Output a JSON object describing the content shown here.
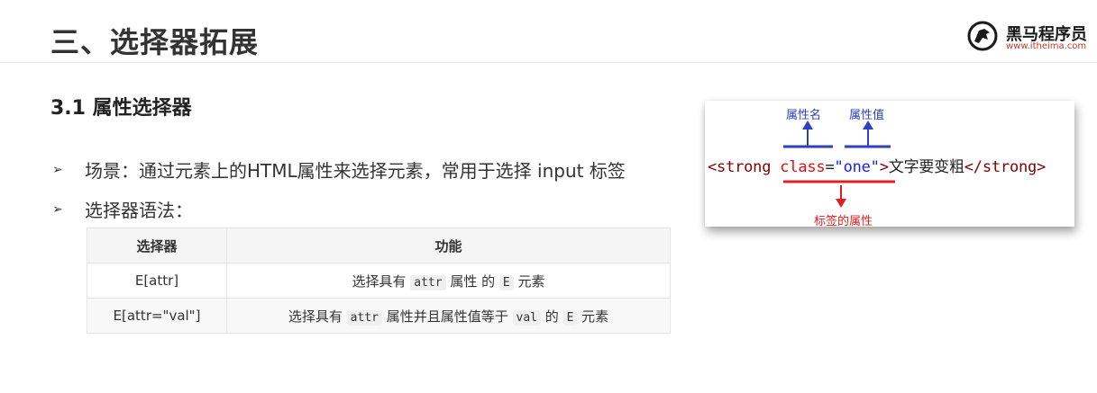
{
  "header": {
    "title": "三、选择器拓展",
    "logo": {
      "name": "黑马程序员",
      "url": "www.itheima.com"
    }
  },
  "section": {
    "title": "3.1 属性选择器"
  },
  "bullets": [
    {
      "marker": "➢",
      "text": "场景：通过元素上的HTML属性来选择元素，常用于选择 input 标签"
    },
    {
      "marker": "➢",
      "text": "选择器语法："
    }
  ],
  "table": {
    "headers": [
      "选择器",
      "功能"
    ],
    "rows": [
      {
        "selector": "E[attr]",
        "desc": {
          "p1": "选择具有",
          "c1": "attr",
          "p2": "属性 的",
          "c2": "E",
          "p3": "元素"
        }
      },
      {
        "selector": "E[attr=\"val\"]",
        "desc": {
          "p1": "选择具有",
          "c1": "attr",
          "p2": "属性并且属性值等于",
          "c2": "val",
          "p3": "的",
          "c3": "E",
          "p4": "元素"
        }
      }
    ]
  },
  "diagram": {
    "label_attr_name": "属性名",
    "label_attr_value": "属性值",
    "label_tag_attr": "标签的属性",
    "code": {
      "open": "<strong",
      "attr": "class",
      "eq": "=",
      "value": "\"one\"",
      "close": ">",
      "text": "文字要变粗",
      "end": "</strong>"
    },
    "colors": {
      "blue": "#2e3fbf",
      "red": "#e02020"
    }
  }
}
